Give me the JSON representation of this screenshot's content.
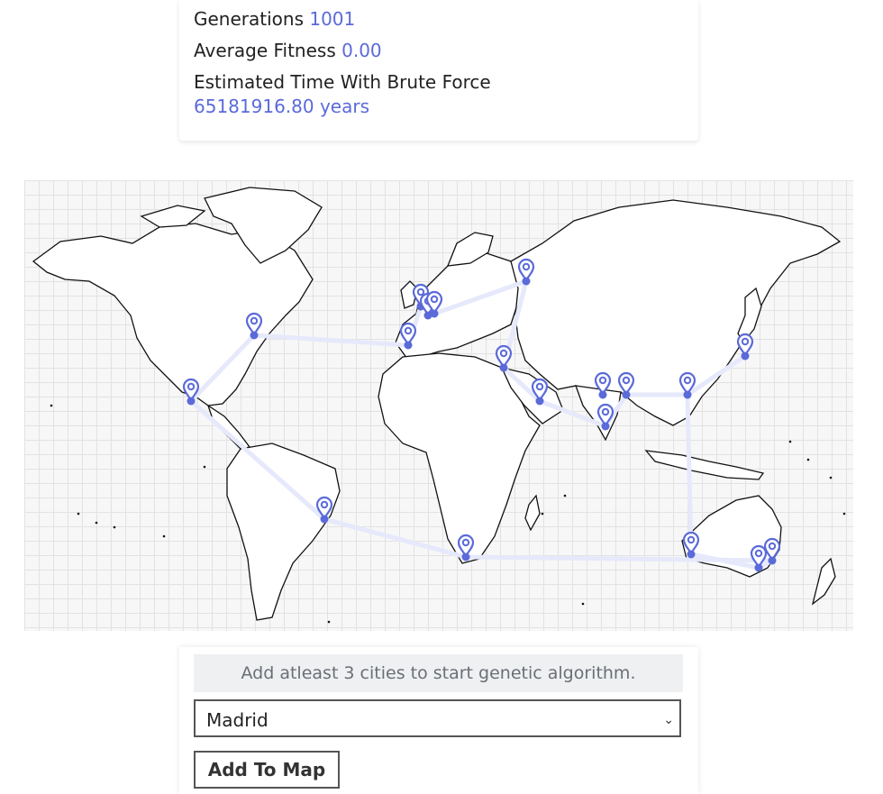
{
  "stats": {
    "generations_label": "Generations",
    "generations_value": "1001",
    "fitness_label": "Average Fitness",
    "fitness_value": "0.00",
    "brute_label": "Estimated Time With Brute Force",
    "brute_value": "65181916.80 years"
  },
  "map": {
    "accent_color": "#5b6ad9",
    "route_color": "#e6e9fb",
    "marker_icon": "map-pin-icon"
  },
  "controls": {
    "notice": "Add atleast 3 cities to start genetic algorithm.",
    "city_select_value": "Madrid",
    "add_button_label": "Add To Map"
  }
}
